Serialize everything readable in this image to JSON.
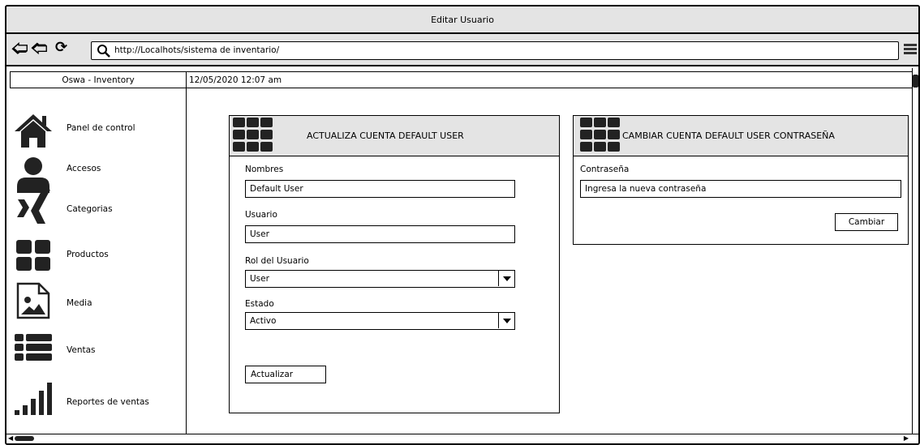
{
  "window": {
    "title": "Editar Usuario"
  },
  "browser": {
    "back_icon": "left-arrow-icon",
    "forward_icon": "right-arrow-icon",
    "reload_icon": "reload-icon",
    "url": "http://Localhots/sistema de inventario/"
  },
  "app": {
    "name": "Oswa - Inventory",
    "datetime": "12/05/2020 12:07 am"
  },
  "sidebar": {
    "items": [
      {
        "label": "Panel de control",
        "icon": "home-icon"
      },
      {
        "label": "Accesos",
        "icon": "user-icon"
      },
      {
        "label": "Categorias",
        "icon": "xing-icon"
      },
      {
        "label": "Productos",
        "icon": "grid-icon"
      },
      {
        "label": "Media",
        "icon": "image-icon"
      },
      {
        "label": "Ventas",
        "icon": "list-icon"
      },
      {
        "label": "Reportes de ventas",
        "icon": "signal-bars-icon"
      }
    ]
  },
  "update_panel": {
    "title": "ACTUALIZA CUENTA DEFAULT USER",
    "nombres_label": "Nombres",
    "nombres_value": "Default User",
    "usuario_label": "Usuario",
    "usuario_value": "User",
    "rol_label": "Rol del Usuario",
    "rol_value": "User",
    "estado_label": "Estado",
    "estado_value": "Activo",
    "submit_label": "Actualizar"
  },
  "password_panel": {
    "title": "CAMBIAR CUENTA DEFAULT USER CONTRASEÑA",
    "password_label": "Contraseña",
    "password_placeholder": "Ingresa la nueva contraseña",
    "submit_label": "Cambiar"
  }
}
